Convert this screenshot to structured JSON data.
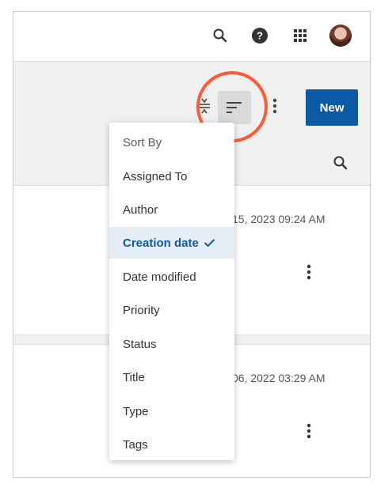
{
  "colors": {
    "accent": "#0b5aa6",
    "annotation": "#ff5a36",
    "selected_bg": "#e5eef6"
  },
  "header": {
    "icons": [
      "search-icon",
      "help-icon",
      "apps-grid-icon",
      "avatar"
    ]
  },
  "toolbar": {
    "new_label": "New",
    "icons": [
      "collapse-icon",
      "sort-icon",
      "more-vertical-icon"
    ]
  },
  "sort_menu": {
    "title": "Sort By",
    "items": [
      {
        "label": "Assigned To"
      },
      {
        "label": "Author"
      },
      {
        "label": "Creation date",
        "selected": true
      },
      {
        "label": "Date modified"
      },
      {
        "label": "Priority"
      },
      {
        "label": "Status"
      },
      {
        "label": "Title"
      },
      {
        "label": "Type"
      },
      {
        "label": "Tags"
      }
    ]
  },
  "cards": [
    {
      "date": "15, 2023 09:24 AM"
    },
    {
      "date": "06, 2022 03:29 AM"
    }
  ]
}
